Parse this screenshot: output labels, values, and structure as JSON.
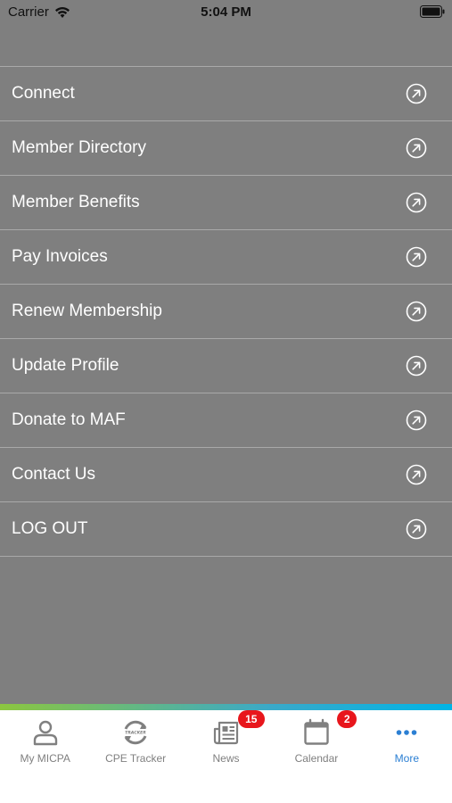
{
  "status_bar": {
    "carrier": "Carrier",
    "time": "5:04 PM"
  },
  "menu": {
    "items": [
      {
        "label": "Connect"
      },
      {
        "label": "Member Directory"
      },
      {
        "label": "Member Benefits"
      },
      {
        "label": "Pay Invoices"
      },
      {
        "label": "Renew Membership"
      },
      {
        "label": "Update Profile"
      },
      {
        "label": "Donate to MAF"
      },
      {
        "label": "Contact Us"
      },
      {
        "label": "LOG OUT"
      }
    ],
    "arrow_icon": "arrow-up-right-circle-icon"
  },
  "tab_bar": {
    "tabs": [
      {
        "label": "My MICPA",
        "icon": "person-icon"
      },
      {
        "label": "CPE Tracker",
        "icon": "tracker-icon"
      },
      {
        "label": "News",
        "icon": "newspaper-icon",
        "badge": "15"
      },
      {
        "label": "Calendar",
        "icon": "calendar-icon",
        "badge": "2"
      },
      {
        "label": "More",
        "icon": "more-dots-icon"
      }
    ],
    "active_tab": "More",
    "active_color": "#2b7fd3",
    "badge_color": "#e8161c"
  }
}
